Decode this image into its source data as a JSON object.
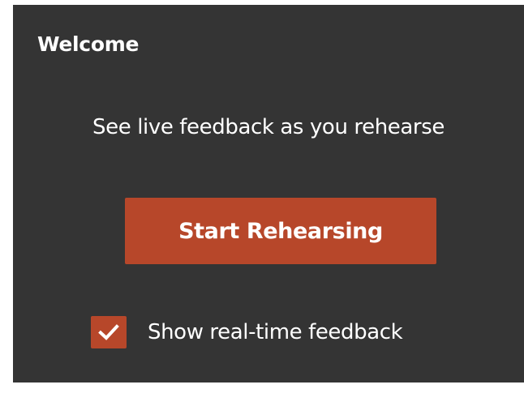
{
  "panel": {
    "title": "Welcome",
    "subtitle": "See live feedback as you rehearse",
    "start_button_label": "Start Rehearsing",
    "feedback_checkbox": {
      "label": "Show real-time feedback",
      "checked": true,
      "icon": "checkmark-icon"
    }
  },
  "colors": {
    "panel_background": "#343434",
    "accent": "#b7472a",
    "text": "#ffffff"
  }
}
